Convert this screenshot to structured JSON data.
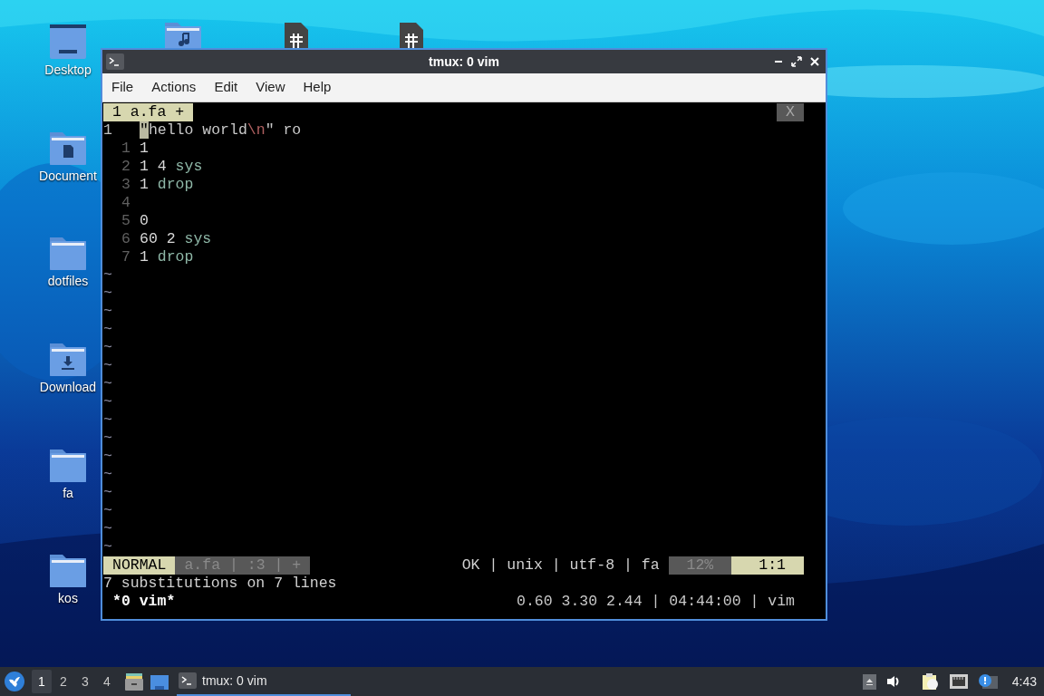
{
  "desktop": {
    "icons": [
      {
        "label": "Desktop",
        "kind": "desktop-folder"
      },
      {
        "label": "Document",
        "kind": "documents-folder"
      },
      {
        "label": "dotfiles",
        "kind": "folder"
      },
      {
        "label": "Download",
        "kind": "downloads-folder"
      },
      {
        "label": "fa",
        "kind": "folder"
      },
      {
        "label": "kos",
        "kind": "folder"
      }
    ],
    "top_icons": [
      {
        "kind": "music-folder"
      },
      {
        "kind": "document"
      },
      {
        "kind": "document"
      }
    ]
  },
  "window": {
    "title": "tmux: 0 vim",
    "menu": [
      "File",
      "Actions",
      "Edit",
      "View",
      "Help"
    ],
    "terminal": {
      "tabline": {
        "tab": "1 a.fa +",
        "close": "X"
      },
      "lines": [
        {
          "number": "1",
          "current": true,
          "tokens": [
            {
              "text": "\"",
              "kind": "cursor"
            },
            {
              "text": "hello world",
              "kind": "string"
            },
            {
              "text": "\\n",
              "kind": "escape"
            },
            {
              "text": "\"",
              "kind": "string"
            },
            {
              "text": " ro",
              "kind": "plain"
            }
          ]
        },
        {
          "number": "1",
          "current": false,
          "tokens": [
            {
              "text": "1",
              "kind": "number"
            }
          ]
        },
        {
          "number": "2",
          "current": false,
          "tokens": [
            {
              "text": "1 4",
              "kind": "number"
            },
            {
              "text": " sys",
              "kind": "keyword"
            }
          ]
        },
        {
          "number": "3",
          "current": false,
          "tokens": [
            {
              "text": "1",
              "kind": "number"
            },
            {
              "text": " drop",
              "kind": "keyword"
            }
          ]
        },
        {
          "number": "4",
          "current": false
        },
        {
          "number": "5",
          "current": false,
          "tokens": [
            {
              "text": "0",
              "kind": "number"
            }
          ]
        },
        {
          "number": "6",
          "current": false,
          "tokens": [
            {
              "text": "60 2",
              "kind": "number"
            },
            {
              "text": " sys",
              "kind": "keyword"
            }
          ]
        },
        {
          "number": "7",
          "current": false,
          "tokens": [
            {
              "text": "1",
              "kind": "number"
            },
            {
              "text": " drop",
              "kind": "keyword"
            }
          ]
        }
      ],
      "empty_lines": [
        "~",
        "~",
        "~",
        "~",
        "~",
        "~",
        "~",
        "~",
        "~",
        "~",
        "~",
        "~",
        "~",
        "~",
        "~",
        "~"
      ],
      "status_line": {
        "mode": "NORMAL",
        "file_info": "a.fa | :3 | +",
        "file_format": "OK | unix | utf-8 | fa",
        "percent": "12%",
        "position": "1:1"
      },
      "message": "7 substitutions on 7 lines",
      "tmux_bar": {
        "window": "*0 vim*",
        "info": "0.60 3.30 2.44 | 04:44:00 | vim"
      }
    }
  },
  "taskbar": {
    "workspaces": [
      {
        "label": "1",
        "selected": true
      },
      {
        "label": "2",
        "selected": false
      },
      {
        "label": "3",
        "selected": false
      },
      {
        "label": "4",
        "selected": false
      }
    ],
    "tasks": [
      {
        "label": "tmux: 0 vim",
        "selected": true
      }
    ],
    "clock": "4:43"
  }
}
